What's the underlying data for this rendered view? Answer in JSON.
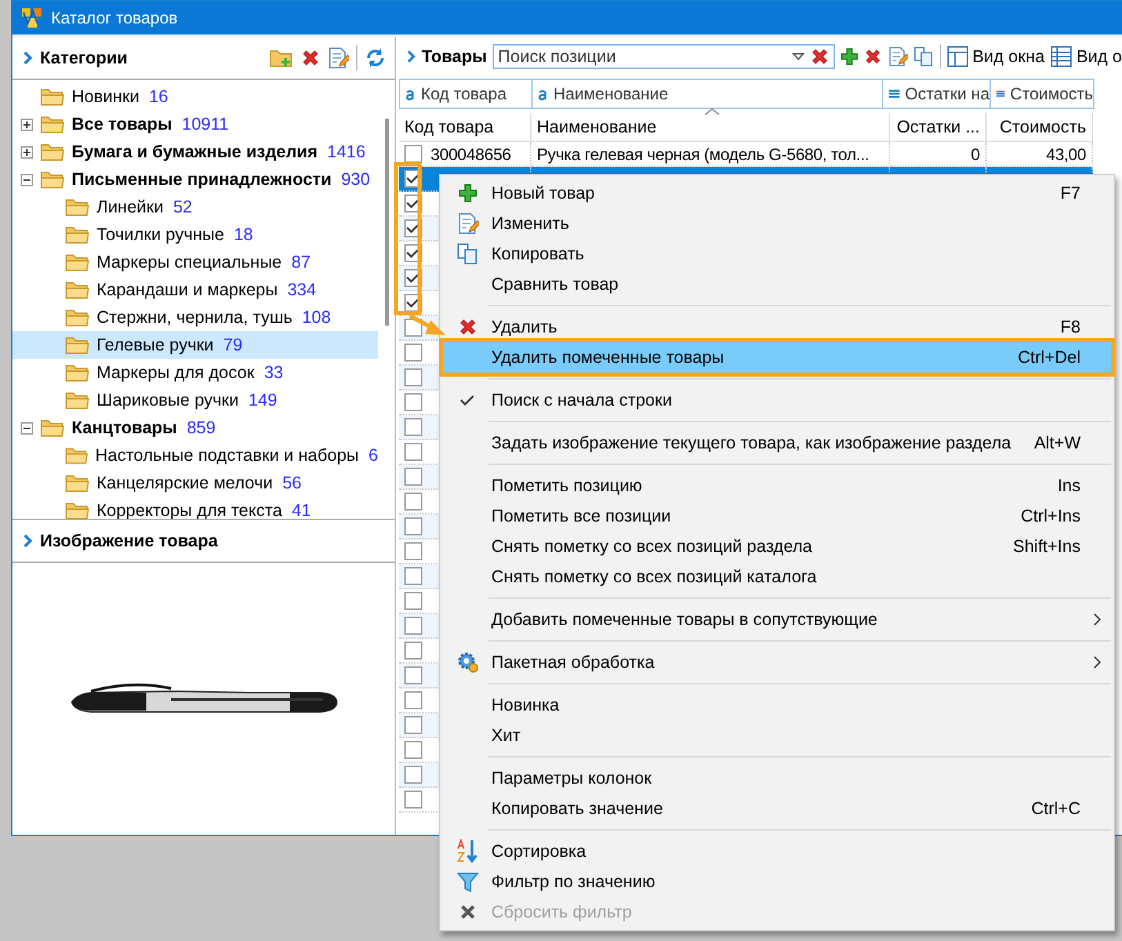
{
  "window": {
    "title": "Каталог товаров"
  },
  "categories": {
    "title": "Категории",
    "tree": [
      {
        "label": "Новинки",
        "count": "16",
        "selected": false
      },
      {
        "label": "Все товары",
        "count": "10911",
        "expanded": false,
        "selected": false
      },
      {
        "label": "Бумага и бумажные изделия",
        "count": "1416",
        "expanded": false,
        "selected": false
      },
      {
        "label": "Письменные принадлежности",
        "count": "930",
        "expanded": true,
        "selected": false,
        "children": [
          {
            "label": "Линейки",
            "count": "52",
            "selected": false
          },
          {
            "label": "Точилки ручные",
            "count": "18",
            "selected": false
          },
          {
            "label": "Маркеры специальные",
            "count": "87",
            "selected": false
          },
          {
            "label": "Карандаши и маркеры",
            "count": "334",
            "selected": false
          },
          {
            "label": "Стержни, чернила, тушь",
            "count": "108",
            "selected": false
          },
          {
            "label": "Гелевые ручки",
            "count": "79",
            "selected": true
          },
          {
            "label": "Маркеры для досок",
            "count": "33",
            "selected": false
          },
          {
            "label": "Шариковые ручки",
            "count": "149",
            "selected": false
          }
        ]
      },
      {
        "label": "Канцтовары",
        "count": "859",
        "expanded": true,
        "selected": false,
        "children": [
          {
            "label": "Настольные подставки и наборы",
            "count": "6",
            "selected": false
          },
          {
            "label": "Канцелярские мелочи",
            "count": "56",
            "selected": false
          },
          {
            "label": "Корректоры для текста",
            "count": "41",
            "selected": false
          }
        ]
      }
    ]
  },
  "image_panel": {
    "title": "Изображение товара"
  },
  "products": {
    "title": "Товары",
    "search": {
      "placeholder": "Поиск позиции"
    },
    "view_buttons": [
      "Вид окна",
      "Вид о"
    ],
    "filters": [
      "Код товара",
      "Наименование",
      "Остатки на",
      "Стоимость"
    ],
    "columns": [
      "Код товара",
      "Наименование",
      "Остатки ...",
      "Стоимость"
    ],
    "rows": [
      {
        "checked": false,
        "selected": false,
        "code": "300048656",
        "name": "Ручка гелевая черная (модель G-5680, тол...",
        "stock": "0",
        "price": "43,00"
      },
      {
        "checked": true,
        "selected": true
      },
      {
        "checked": true,
        "selected": false
      },
      {
        "checked": true,
        "selected": false
      },
      {
        "checked": true,
        "selected": false
      },
      {
        "checked": true,
        "selected": false
      },
      {
        "checked": true,
        "selected": false
      },
      {
        "checked": false,
        "selected": false
      },
      {
        "checked": false,
        "selected": false
      },
      {
        "checked": false,
        "selected": false
      },
      {
        "checked": false,
        "selected": false
      },
      {
        "checked": false,
        "selected": false
      },
      {
        "checked": false,
        "selected": false
      },
      {
        "checked": false,
        "selected": false
      },
      {
        "checked": false,
        "selected": false
      },
      {
        "checked": false,
        "selected": false
      },
      {
        "checked": false,
        "selected": false
      },
      {
        "checked": false,
        "selected": false
      },
      {
        "checked": false,
        "selected": false
      },
      {
        "checked": false,
        "selected": false
      },
      {
        "checked": false,
        "selected": false
      },
      {
        "checked": false,
        "selected": false
      },
      {
        "checked": false,
        "selected": false
      },
      {
        "checked": false,
        "selected": false
      },
      {
        "checked": false,
        "selected": false
      },
      {
        "checked": false,
        "selected": false
      },
      {
        "checked": false,
        "selected": false
      }
    ]
  },
  "context_menu": [
    {
      "kind": "item",
      "label": "Новый товар",
      "shortcut": "F7",
      "selected": false,
      "checked": false,
      "disabled": false,
      "submenu": false
    },
    {
      "kind": "item",
      "label": "Изменить",
      "selected": false,
      "checked": false,
      "disabled": false,
      "submenu": false
    },
    {
      "kind": "item",
      "label": "Копировать",
      "selected": false,
      "checked": false,
      "disabled": false,
      "submenu": false
    },
    {
      "kind": "item",
      "label": "Сравнить товар",
      "selected": false,
      "checked": false,
      "disabled": false,
      "submenu": false
    },
    {
      "kind": "separator"
    },
    {
      "kind": "item",
      "label": "Удалить",
      "shortcut": "F8",
      "selected": false,
      "checked": false,
      "disabled": false,
      "submenu": false
    },
    {
      "kind": "item",
      "label": "Удалить помеченные товары",
      "shortcut": "Ctrl+Del",
      "selected": true,
      "checked": false,
      "disabled": false,
      "submenu": false
    },
    {
      "kind": "separator"
    },
    {
      "kind": "item",
      "label": "Поиск с начала строки",
      "selected": false,
      "checked": true,
      "disabled": false,
      "submenu": false
    },
    {
      "kind": "separator"
    },
    {
      "kind": "item",
      "label": "Задать изображение текущего товара, как изображение раздела",
      "shortcut": "Alt+W",
      "selected": false,
      "checked": false,
      "disabled": false,
      "submenu": false
    },
    {
      "kind": "separator"
    },
    {
      "kind": "item",
      "label": "Пометить позицию",
      "shortcut": "Ins",
      "selected": false,
      "checked": false,
      "disabled": false,
      "submenu": false
    },
    {
      "kind": "item",
      "label": "Пометить все позиции",
      "shortcut": "Ctrl+Ins",
      "selected": false,
      "checked": false,
      "disabled": false,
      "submenu": false
    },
    {
      "kind": "item",
      "label": "Снять пометку со всех позиций раздела",
      "shortcut": "Shift+Ins",
      "selected": false,
      "checked": false,
      "disabled": false,
      "submenu": false
    },
    {
      "kind": "item",
      "label": "Снять пометку со всех позиций каталога",
      "selected": false,
      "checked": false,
      "disabled": false,
      "submenu": false
    },
    {
      "kind": "separator"
    },
    {
      "kind": "item",
      "label": "Добавить помеченные товары в сопутствующие",
      "selected": false,
      "checked": false,
      "disabled": false,
      "submenu": true
    },
    {
      "kind": "separator"
    },
    {
      "kind": "item",
      "label": "Пакетная обработка",
      "selected": false,
      "checked": false,
      "disabled": false,
      "submenu": true
    },
    {
      "kind": "separator"
    },
    {
      "kind": "item",
      "label": "Новинка",
      "selected": false,
      "checked": false,
      "disabled": false,
      "submenu": false
    },
    {
      "kind": "item",
      "label": "Хит",
      "selected": false,
      "checked": false,
      "disabled": false,
      "submenu": false
    },
    {
      "kind": "separator"
    },
    {
      "kind": "item",
      "label": "Параметры колонок",
      "selected": false,
      "checked": false,
      "disabled": false,
      "submenu": false
    },
    {
      "kind": "item",
      "label": "Копировать значение",
      "shortcut": "Ctrl+C",
      "selected": false,
      "checked": false,
      "disabled": false,
      "submenu": false
    },
    {
      "kind": "separator"
    },
    {
      "kind": "item",
      "label": "Сортировка",
      "selected": false,
      "checked": false,
      "disabled": false,
      "submenu": false
    },
    {
      "kind": "item",
      "label": "Фильтр по значению",
      "selected": false,
      "checked": false,
      "disabled": false,
      "submenu": false
    },
    {
      "kind": "item",
      "label": "Сбросить фильтр",
      "selected": false,
      "checked": false,
      "disabled": true,
      "submenu": false
    }
  ]
}
